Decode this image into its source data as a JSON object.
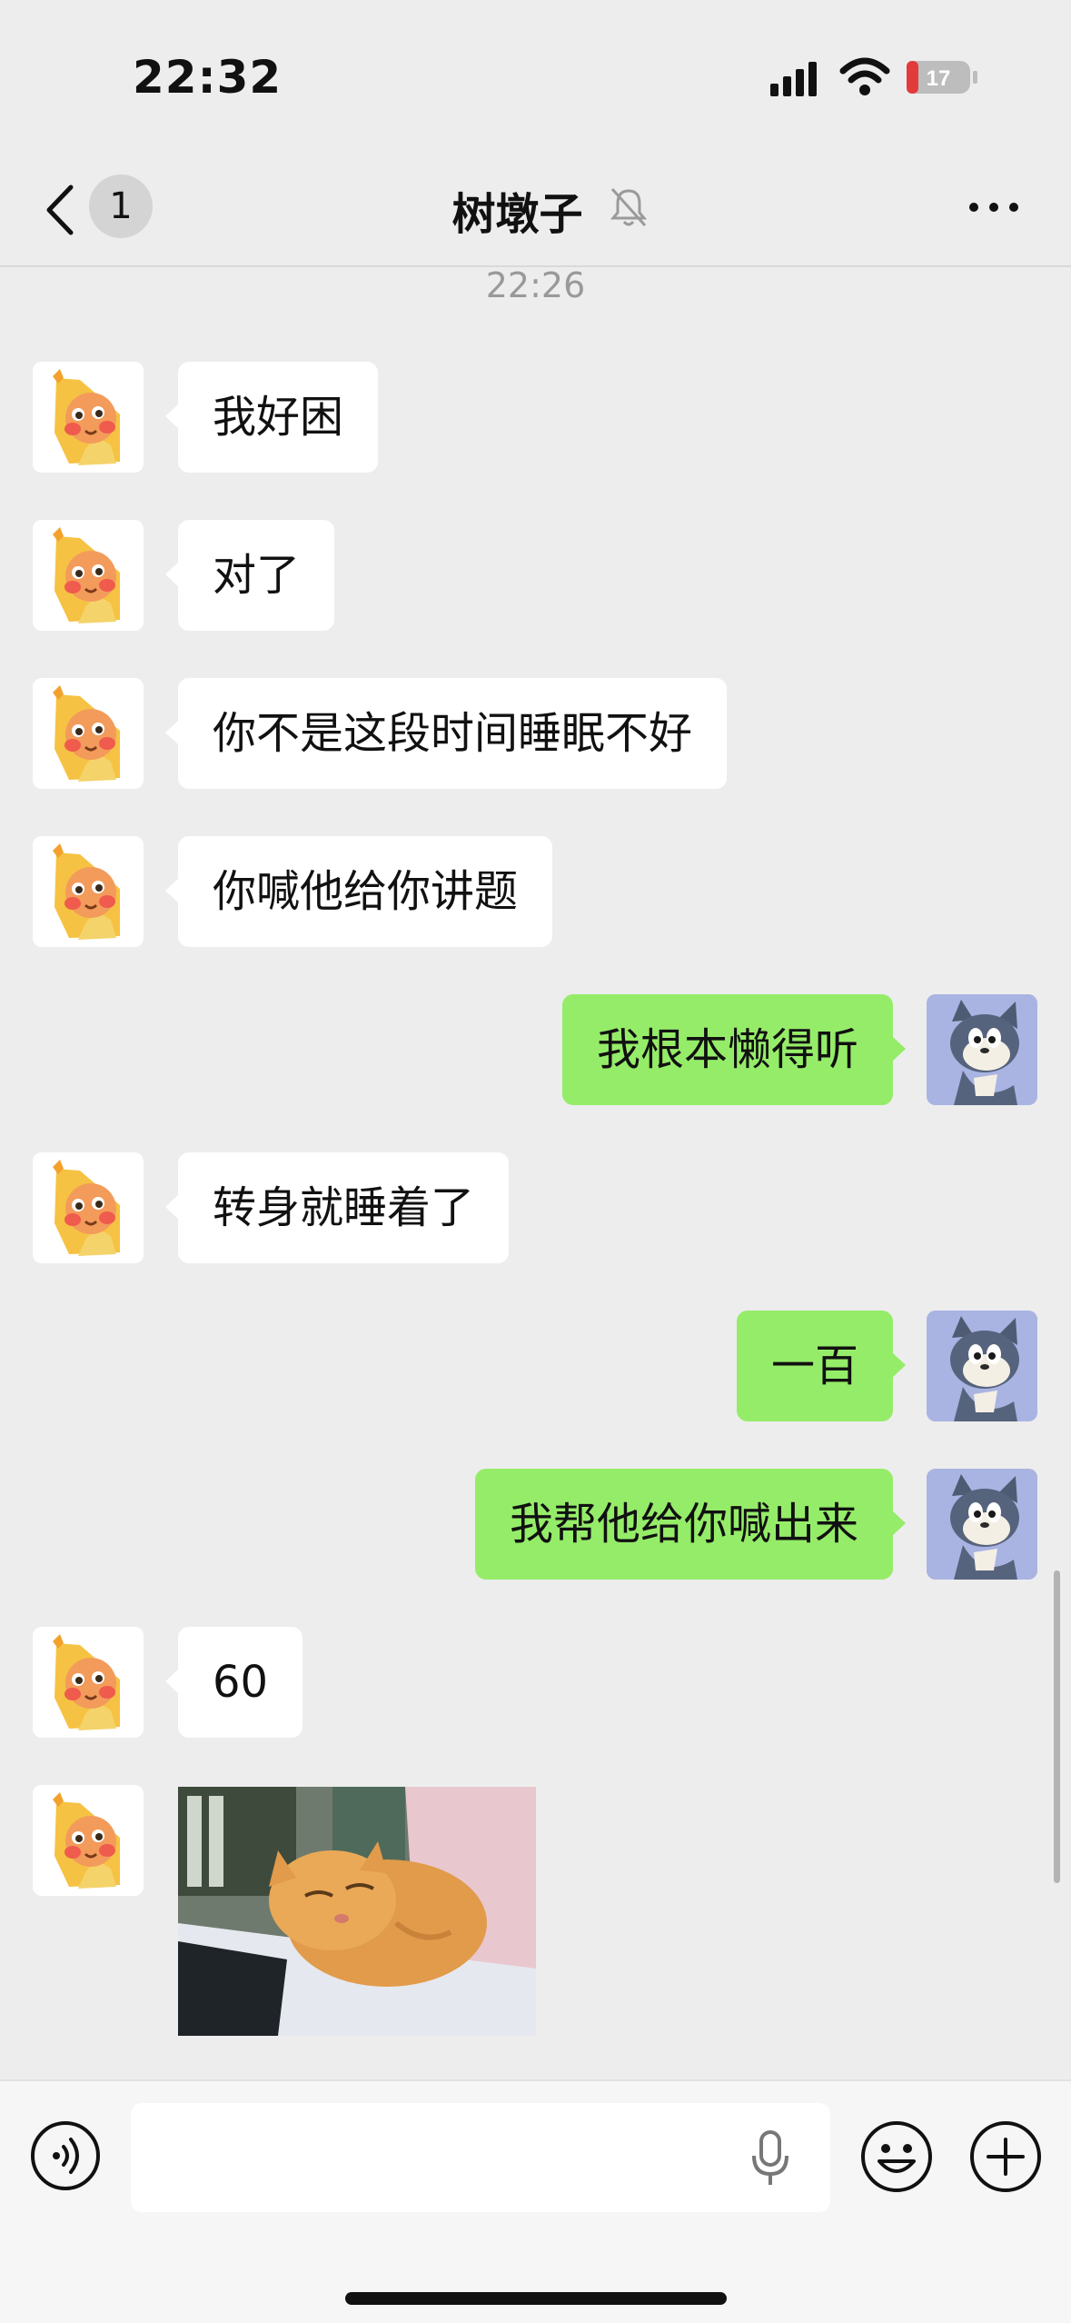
{
  "status_bar": {
    "time": "22:32",
    "battery_level": "17"
  },
  "header": {
    "back_count": "1",
    "title": "树墩子",
    "muted": true
  },
  "timestamp": "22:26",
  "messages": [
    {
      "sender": "other",
      "text": "我好困"
    },
    {
      "sender": "other",
      "text": "对了"
    },
    {
      "sender": "other",
      "text": "你不是这段时间睡眠不好"
    },
    {
      "sender": "other",
      "text": "你喊他给你讲题"
    },
    {
      "sender": "me",
      "text": "我根本懒得听"
    },
    {
      "sender": "other",
      "text": "转身就睡着了"
    },
    {
      "sender": "me",
      "text": "一百"
    },
    {
      "sender": "me",
      "text": "我帮他给你喊出来"
    },
    {
      "sender": "other",
      "text": "60"
    },
    {
      "sender": "other",
      "type": "image"
    }
  ],
  "input": {
    "value": "",
    "placeholder": ""
  },
  "colors": {
    "background": "#ededed",
    "incoming_bubble": "#ffffff",
    "outgoing_bubble": "#95ec69",
    "battery_low": "#e33b3b"
  },
  "icons": [
    "back-icon",
    "mute-icon",
    "more-icon",
    "voice-icon",
    "mic-icon",
    "emoji-icon",
    "plus-icon"
  ]
}
